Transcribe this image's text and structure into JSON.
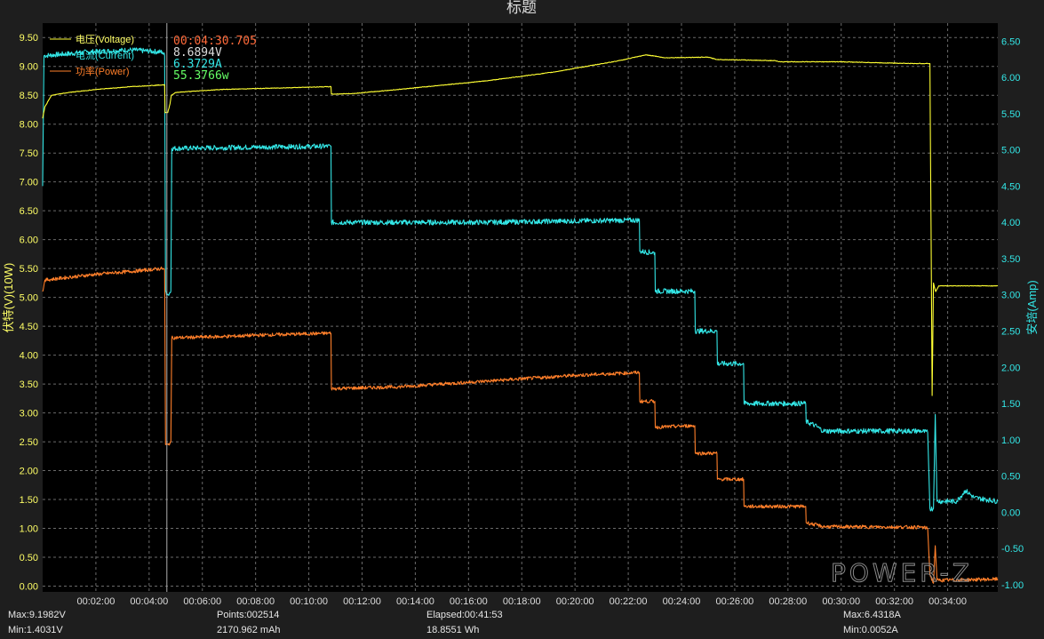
{
  "chart_data": {
    "type": "line",
    "title": "标题",
    "y_left_label": "伏特(V)(10W)",
    "y_right_label": "安培(Amp)",
    "y_left_range": [
      -0.1,
      9.75
    ],
    "y_right_range": [
      -1.1,
      6.75
    ],
    "x_range_seconds": [
      0,
      2153
    ],
    "y_left_ticks": [
      "9.50",
      "9.00",
      "8.50",
      "8.00",
      "7.50",
      "7.00",
      "6.50",
      "6.00",
      "5.50",
      "5.00",
      "4.50",
      "4.00",
      "3.50",
      "3.00",
      "2.50",
      "2.00",
      "1.50",
      "1.00",
      "0.50",
      "0.00"
    ],
    "y_right_ticks": [
      "6.50",
      "6.00",
      "5.50",
      "5.00",
      "4.50",
      "4.00",
      "3.50",
      "3.00",
      "2.50",
      "2.00",
      "1.50",
      "1.00",
      "0.50",
      "0.00",
      "-0.50",
      "-1.00"
    ],
    "x_ticks": [
      "00:02:00",
      "00:04:00",
      "00:06:00",
      "00:08:00",
      "00:10:00",
      "00:12:00",
      "00:14:00",
      "00:16:00",
      "00:18:00",
      "00:20:00",
      "00:22:00",
      "00:24:00",
      "00:26:00",
      "00:28:00",
      "00:30:00",
      "00:32:00",
      "00:34:00"
    ],
    "grid": true,
    "legend_position": "top-left",
    "series": [
      {
        "name": "电压(Voltage)",
        "axis": "left",
        "color": "#ffff33",
        "points": [
          [
            0,
            8.1
          ],
          [
            5,
            8.3
          ],
          [
            20,
            8.5
          ],
          [
            60,
            8.55
          ],
          [
            120,
            8.6
          ],
          [
            200,
            8.65
          ],
          [
            270,
            8.68
          ],
          [
            275,
            8.68
          ],
          [
            276,
            8.2
          ],
          [
            282,
            8.2
          ],
          [
            287,
            8.35
          ],
          [
            290,
            8.5
          ],
          [
            300,
            8.55
          ],
          [
            400,
            8.6
          ],
          [
            650,
            8.65
          ],
          [
            651,
            8.52
          ],
          [
            700,
            8.53
          ],
          [
            800,
            8.6
          ],
          [
            1000,
            8.75
          ],
          [
            1150,
            8.9
          ],
          [
            1300,
            9.1
          ],
          [
            1360,
            9.2
          ],
          [
            1380,
            9.18
          ],
          [
            1400,
            9.15
          ],
          [
            1500,
            9.16
          ],
          [
            1520,
            9.12
          ],
          [
            1650,
            9.1
          ],
          [
            1660,
            9.08
          ],
          [
            1800,
            9.08
          ],
          [
            1850,
            9.07
          ],
          [
            1960,
            9.05
          ],
          [
            2000,
            9.05
          ],
          [
            2005,
            3.3
          ],
          [
            2008,
            5.25
          ],
          [
            2013,
            5.1
          ],
          [
            2020,
            5.2
          ],
          [
            2153,
            5.2
          ]
        ]
      },
      {
        "name": "电流(Current)",
        "axis": "right",
        "color": "#33e6e6",
        "points": [
          [
            0,
            4.5
          ],
          [
            3,
            6.3
          ],
          [
            100,
            6.35
          ],
          [
            200,
            6.38
          ],
          [
            270,
            6.35
          ],
          [
            275,
            6.3
          ],
          [
            277,
            3.05
          ],
          [
            283,
            3.0
          ],
          [
            289,
            3.05
          ],
          [
            291,
            5.02
          ],
          [
            400,
            5.03
          ],
          [
            500,
            5.04
          ],
          [
            650,
            5.05
          ],
          [
            651,
            4.0
          ],
          [
            800,
            4.0
          ],
          [
            1000,
            4.0
          ],
          [
            1200,
            4.02
          ],
          [
            1345,
            4.03
          ],
          [
            1346,
            3.6
          ],
          [
            1380,
            3.58
          ],
          [
            1381,
            3.05
          ],
          [
            1470,
            3.05
          ],
          [
            1471,
            2.5
          ],
          [
            1520,
            2.5
          ],
          [
            1521,
            2.05
          ],
          [
            1580,
            2.05
          ],
          [
            1581,
            1.5
          ],
          [
            1720,
            1.5
          ],
          [
            1721,
            1.25
          ],
          [
            1740,
            1.2
          ],
          [
            1760,
            1.12
          ],
          [
            1900,
            1.12
          ],
          [
            1980,
            1.12
          ],
          [
            1995,
            1.1
          ],
          [
            2000,
            0.05
          ],
          [
            2008,
            0.05
          ],
          [
            2012,
            1.35
          ],
          [
            2016,
            0.15
          ],
          [
            2060,
            0.15
          ],
          [
            2080,
            0.3
          ],
          [
            2100,
            0.2
          ],
          [
            2153,
            0.15
          ]
        ]
      },
      {
        "name": "功率(Power)",
        "axis": "left",
        "color": "#ff7f2a",
        "points": [
          [
            0,
            5.1
          ],
          [
            5,
            5.3
          ],
          [
            60,
            5.35
          ],
          [
            120,
            5.4
          ],
          [
            200,
            5.45
          ],
          [
            270,
            5.5
          ],
          [
            275,
            5.48
          ],
          [
            277,
            2.45
          ],
          [
            283,
            2.45
          ],
          [
            289,
            2.5
          ],
          [
            291,
            4.3
          ],
          [
            400,
            4.32
          ],
          [
            500,
            4.35
          ],
          [
            650,
            4.38
          ],
          [
            651,
            3.42
          ],
          [
            800,
            3.45
          ],
          [
            1000,
            3.55
          ],
          [
            1200,
            3.65
          ],
          [
            1345,
            3.7
          ],
          [
            1346,
            3.2
          ],
          [
            1380,
            3.2
          ],
          [
            1381,
            2.75
          ],
          [
            1470,
            2.78
          ],
          [
            1471,
            2.3
          ],
          [
            1520,
            2.3
          ],
          [
            1521,
            1.85
          ],
          [
            1580,
            1.85
          ],
          [
            1581,
            1.38
          ],
          [
            1720,
            1.38
          ],
          [
            1721,
            1.1
          ],
          [
            1760,
            1.03
          ],
          [
            1980,
            1.02
          ],
          [
            1995,
            1.0
          ],
          [
            2000,
            0.2
          ],
          [
            2008,
            0.05
          ],
          [
            2012,
            0.7
          ],
          [
            2016,
            0.1
          ],
          [
            2153,
            0.12
          ]
        ]
      }
    ],
    "cursor_time_seconds": 270,
    "readout": {
      "time": "00:04:30.705",
      "voltage": "8.6894V",
      "current": "6.3729A",
      "power": "55.3766w"
    },
    "footer": {
      "max_v": "Max:9.1982V",
      "min_v": "Min:1.4031V",
      "points": "Points:002514",
      "capacity": "2170.962 mAh",
      "elapsed": "Elapsed:00:41:53",
      "energy": "18.8551 Wh",
      "max_a": "Max:6.4318A",
      "min_a": "Min:0.0052A"
    },
    "brand": "POWER-Z"
  }
}
